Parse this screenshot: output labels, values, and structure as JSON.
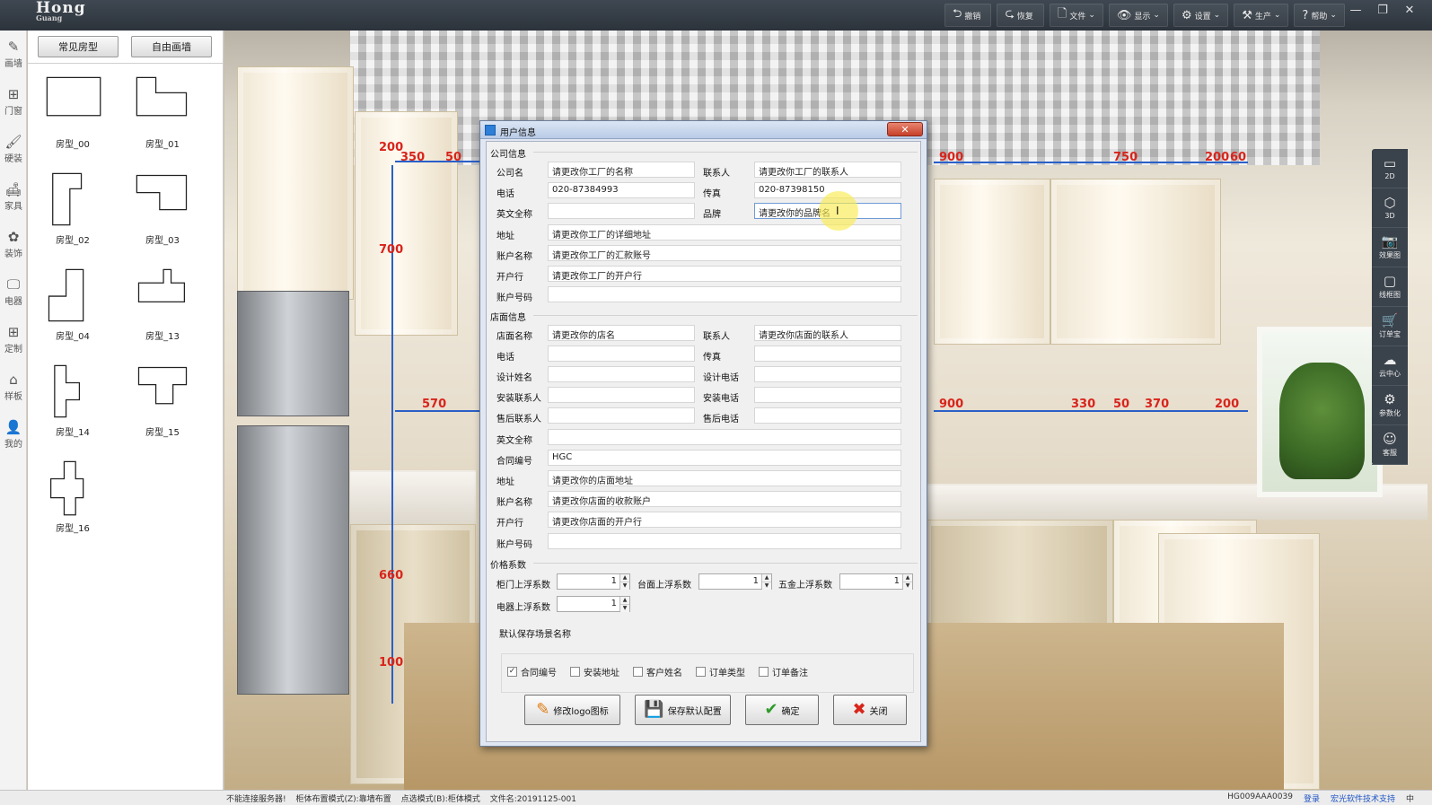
{
  "app": {
    "logo": "Hong",
    "logo_sub": "Guang"
  },
  "toolbar": [
    {
      "label": "撤销",
      "icon": "undo-icon",
      "glyph": "⮌",
      "dd": ""
    },
    {
      "label": "恢复",
      "icon": "redo-icon",
      "glyph": "⮎",
      "dd": ""
    },
    {
      "label": "文件",
      "icon": "file-icon",
      "glyph": "🗋",
      "dd": "⌄"
    },
    {
      "label": "显示",
      "icon": "eye-icon",
      "glyph": "👁",
      "dd": "⌄"
    },
    {
      "label": "设置",
      "icon": "gear-icon",
      "glyph": "⚙",
      "dd": "⌄"
    },
    {
      "label": "生产",
      "icon": "hammer-icon",
      "glyph": "⚒",
      "dd": "⌄"
    },
    {
      "label": "帮助",
      "icon": "help-icon",
      "glyph": "?",
      "dd": "⌄"
    }
  ],
  "window_controls": {
    "min": "—",
    "max": "❐",
    "close": "✕"
  },
  "left_nav": [
    {
      "label": "画墙",
      "glyph": "✎"
    },
    {
      "label": "门窗",
      "glyph": "⊞"
    },
    {
      "label": "硬装",
      "glyph": "🖌"
    },
    {
      "label": "家具",
      "glyph": "🛋"
    },
    {
      "label": "装饰",
      "glyph": "✿"
    },
    {
      "label": "电器",
      "glyph": "🖵"
    },
    {
      "label": "定制",
      "glyph": "⊞"
    },
    {
      "label": "样板",
      "glyph": "⌂"
    },
    {
      "label": "我的",
      "glyph": "👤"
    }
  ],
  "room_panel": {
    "tabs": [
      "常见房型",
      "自由画墙"
    ],
    "shapes": [
      "房型_00",
      "房型_01",
      "房型_02",
      "房型_03",
      "房型_04",
      "房型_13",
      "房型_14",
      "房型_15",
      "房型_16"
    ]
  },
  "dimensions": [
    "200",
    "350",
    "50",
    "700",
    "570",
    "660",
    "100",
    "900",
    "750",
    "200",
    "60",
    "900",
    "330",
    "50",
    "370",
    "200"
  ],
  "right_toolbar": [
    {
      "label": "2D",
      "glyph": "▭"
    },
    {
      "label": "3D",
      "glyph": "⬡"
    },
    {
      "label": "效果图",
      "glyph": "📷"
    },
    {
      "label": "线框图",
      "glyph": "▢"
    },
    {
      "label": "订单宝",
      "glyph": "🛒"
    },
    {
      "label": "云中心",
      "glyph": "☁"
    },
    {
      "label": "参数化",
      "glyph": "⚙"
    },
    {
      "label": "客服",
      "glyph": "☺"
    }
  ],
  "status": {
    "items": [
      "不能连接服务器!",
      "柜体布置模式(Z):靠墙布置",
      "点选模式(B):柜体模式",
      "文件名:20191125-001"
    ],
    "right_code": "HG009AAA0039",
    "login": "登录",
    "support": "宏光软件技术支持",
    "lang": "中"
  },
  "dialog": {
    "title": "用户信息",
    "close": "✕",
    "company": {
      "section": "公司信息",
      "name_label": "公司名",
      "name": "请更改你工厂的名称",
      "contact_label": "联系人",
      "contact": "请更改你工厂的联系人",
      "phone_label": "电话",
      "phone": "020-87384993",
      "fax_label": "传真",
      "fax": "020-87398150",
      "en_label": "英文全称",
      "en": "",
      "brand_label": "品牌",
      "brand": "请更改你的品牌名",
      "addr_label": "地址",
      "addr": "请更改你工厂的详细地址",
      "acct_name_label": "账户名称",
      "acct_name": "请更改你工厂的汇款账号",
      "bank_label": "开户行",
      "bank": "请更改你工厂的开户行",
      "acct_no_label": "账户号码",
      "acct_no": ""
    },
    "store": {
      "section": "店面信息",
      "name_label": "店面名称",
      "name": "请更改你的店名",
      "contact_label": "联系人",
      "contact": "请更改你店面的联系人",
      "phone_label": "电话",
      "phone": "",
      "fax_label": "传真",
      "fax": "",
      "designer_label": "设计姓名",
      "designer": "",
      "designer_phone_label": "设计电话",
      "designer_phone": "",
      "install_contact_label": "安装联系人",
      "install_contact": "",
      "install_phone_label": "安装电话",
      "install_phone": "",
      "after_contact_label": "售后联系人",
      "after_contact": "",
      "after_phone_label": "售后电话",
      "after_phone": "",
      "en_label": "英文全称",
      "en": "",
      "contract_label": "合同编号",
      "contract": "HGC",
      "addr_label": "地址",
      "addr": "请更改你的店面地址",
      "acct_name_label": "账户名称",
      "acct_name": "请更改你店面的收款账户",
      "bank_label": "开户行",
      "bank": "请更改你店面的开户行",
      "acct_no_label": "账户号码",
      "acct_no": ""
    },
    "price": {
      "section": "价格系数",
      "door_label": "柜门上浮系数",
      "door": "1",
      "top_label": "台面上浮系数",
      "top": "1",
      "hw_label": "五金上浮系数",
      "hw": "1",
      "elec_label": "电器上浮系数",
      "elec": "1"
    },
    "save_name": {
      "section": "默认保存场景名称",
      "options": [
        {
          "label": "合同编号",
          "checked": true
        },
        {
          "label": "安装地址",
          "checked": false
        },
        {
          "label": "客户姓名",
          "checked": false
        },
        {
          "label": "订单类型",
          "checked": false
        },
        {
          "label": "订单备注",
          "checked": false
        }
      ]
    },
    "buttons": {
      "logo": "修改logo图标",
      "save_default": "保存默认配置",
      "ok": "确定",
      "close": "关闭"
    }
  }
}
